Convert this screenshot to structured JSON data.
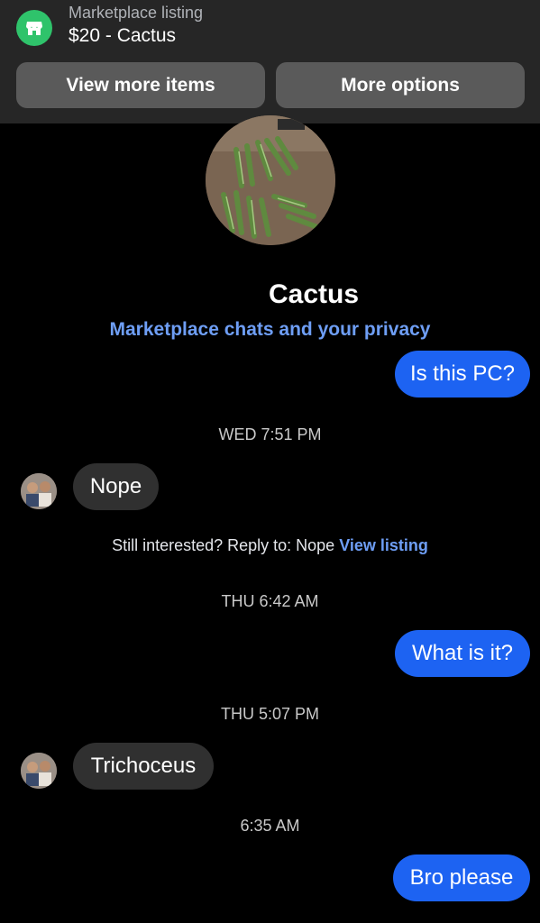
{
  "header": {
    "label": "Marketplace listing",
    "title": "$20 - Cactus",
    "view_more_label": "View more items",
    "more_options_label": "More options",
    "icon": "storefront-icon",
    "icon_color": "#2fc36b"
  },
  "profile": {
    "name": "Cactus",
    "privacy_link": "Marketplace chats and your privacy"
  },
  "messages": [
    {
      "type": "outgoing",
      "text": "Is this PC?"
    },
    {
      "type": "timestamp",
      "text": "WED 7:51 PM"
    },
    {
      "type": "incoming",
      "text": "Nope"
    },
    {
      "type": "reply_prompt",
      "text": "Still interested? Reply to: Nope",
      "link": "View listing"
    },
    {
      "type": "timestamp",
      "text": "THU 6:42 AM"
    },
    {
      "type": "outgoing",
      "text": "What is it?"
    },
    {
      "type": "timestamp",
      "text": "THU 5:07 PM"
    },
    {
      "type": "incoming",
      "text": "Trichoceus"
    },
    {
      "type": "timestamp",
      "text": "6:35 AM"
    },
    {
      "type": "outgoing",
      "text": "Bro please"
    }
  ],
  "colors": {
    "outgoing_bubble": "#1d63f2",
    "incoming_bubble": "#303030",
    "link": "#6e9ef5",
    "header_bg": "#262626"
  }
}
